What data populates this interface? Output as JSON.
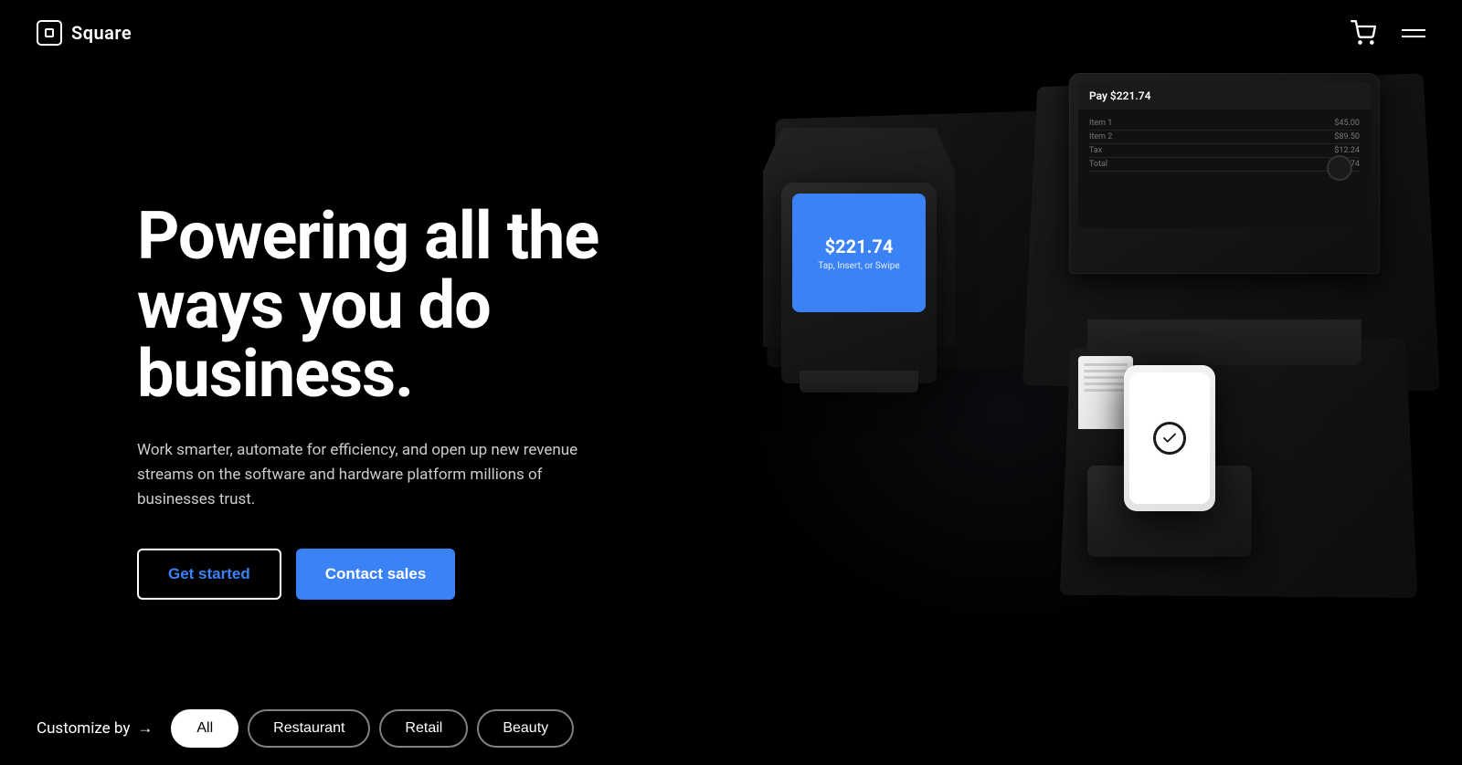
{
  "brand": {
    "logo_text": "Square",
    "logo_icon_label": "square-logo-icon"
  },
  "nav": {
    "cart_label": "Cart",
    "menu_label": "Menu"
  },
  "hero": {
    "title": "Powering all the ways you do business.",
    "subtitle": "Work smarter, automate for efficiency, and open up new revenue streams on the software and hardware platform millions of businesses trust.",
    "get_started_label": "Get started",
    "contact_sales_label": "Contact sales"
  },
  "devices": {
    "terminal": {
      "amount": "$221.74",
      "tap_text": "Tap, Insert, or Swipe"
    },
    "register": {
      "pay_label": "Pay $221.74",
      "lines": [
        {
          "name": "Item 1",
          "price": "$45.00"
        },
        {
          "name": "Item 2",
          "price": "$89.50"
        },
        {
          "name": "Tax",
          "price": "$12.24"
        },
        {
          "name": "Total",
          "price": "$221.74"
        }
      ]
    }
  },
  "customize": {
    "label": "Customize by",
    "arrow": "→",
    "filters": [
      {
        "id": "all",
        "label": "All",
        "active": true
      },
      {
        "id": "restaurant",
        "label": "Restaurant",
        "active": false
      },
      {
        "id": "retail",
        "label": "Retail",
        "active": false
      },
      {
        "id": "beauty",
        "label": "Beauty",
        "active": false
      }
    ]
  },
  "colors": {
    "brand_blue": "#3b82f6",
    "background": "#000000",
    "text_primary": "#ffffff",
    "text_secondary": "#cccccc"
  }
}
